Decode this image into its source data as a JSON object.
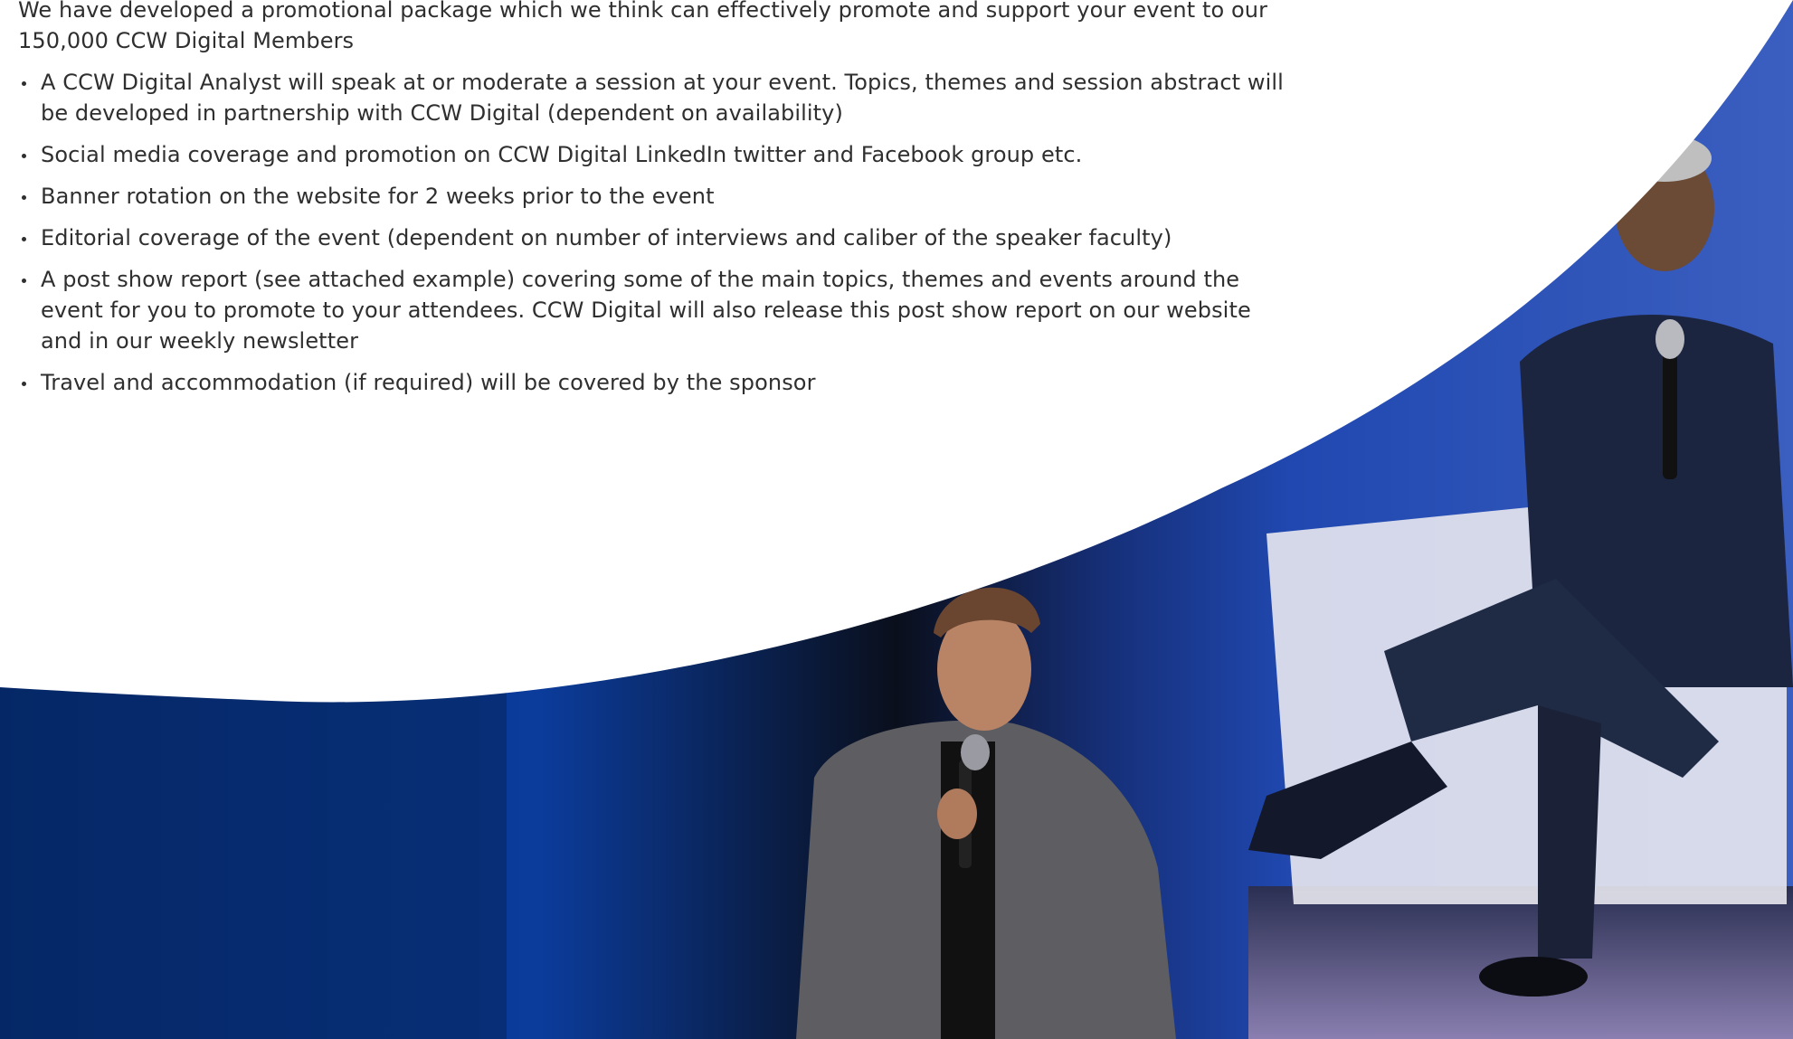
{
  "intro": "We have developed a promotional package which we think can effectively promote and support your event to our 150,000 CCW Digital Members",
  "bullets": [
    "A CCW Digital Analyst will speak at or moderate a session at your event. Topics, themes and session abstract will be developed in partnership with CCW Digital (dependent on availability)",
    "Social media coverage and promotion on CCW Digital LinkedIn twitter and Facebook group etc.",
    "Banner rotation on the website for 2 weeks prior to the event",
    "Editorial coverage of the event (dependent on number of interviews and caliber of the speaker faculty)",
    "A post show report (see attached example) covering some of the main topics, themes and events around the event for you to promote to your attendees. CCW Digital will also release this post show report on our website and in our weekly newsletter",
    "Travel and accommodation (if required) will be covered by the sponsor"
  ],
  "colors": {
    "text": "#2f2f2f",
    "brand_blue": "#1b4fb8",
    "navy": "#0a2a6e"
  }
}
